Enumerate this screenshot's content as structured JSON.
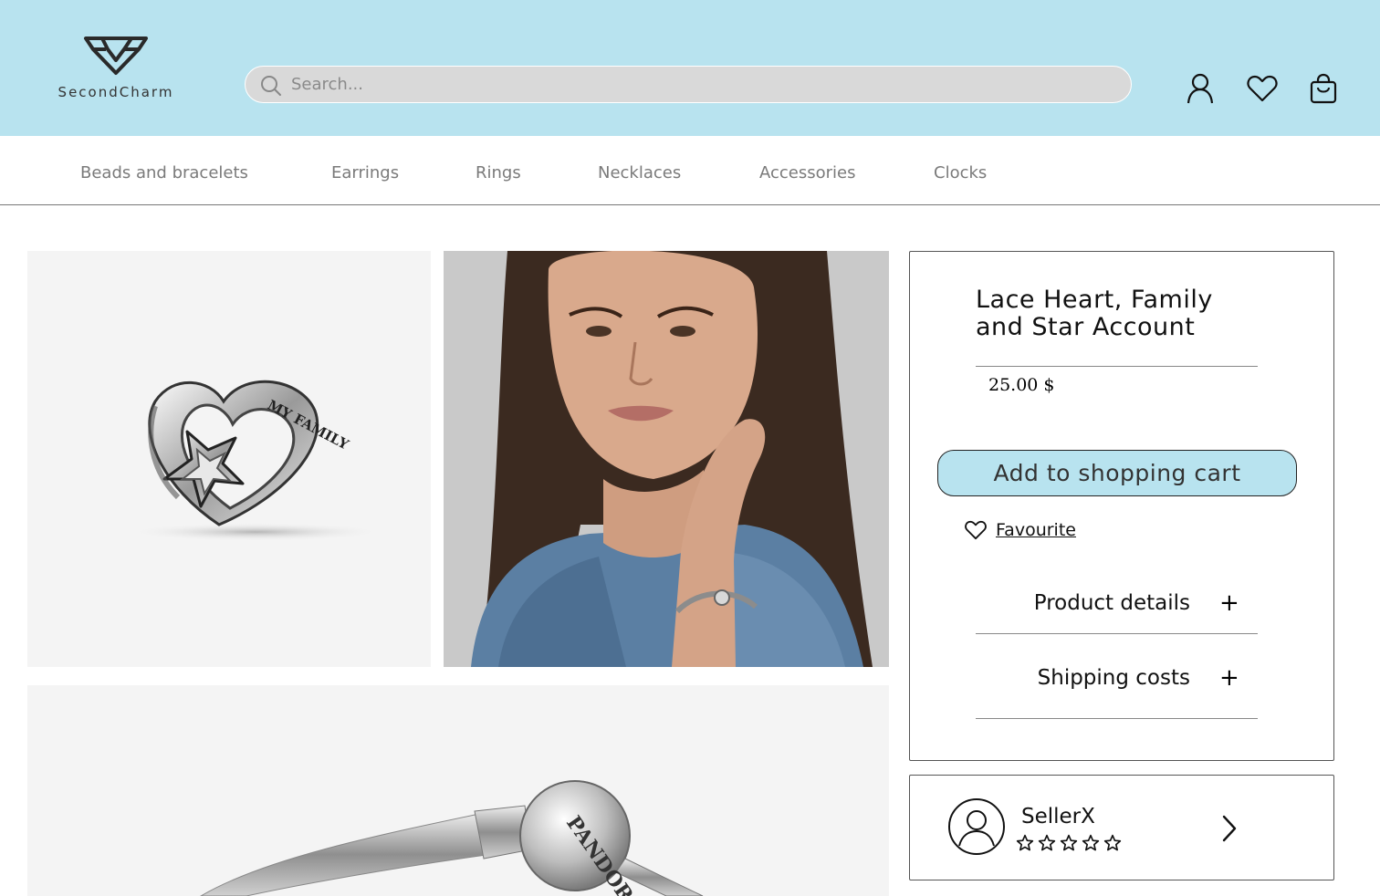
{
  "header": {
    "brand_name": "SecondCharm",
    "search": {
      "placeholder": "Search..."
    },
    "icons": [
      "user-icon",
      "heart-icon",
      "bag-icon"
    ]
  },
  "nav": {
    "items": [
      {
        "label": "Beads and bracelets"
      },
      {
        "label": "Earrings"
      },
      {
        "label": "Rings"
      },
      {
        "label": "Necklaces"
      },
      {
        "label": "Accessories"
      },
      {
        "label": "Clocks"
      }
    ]
  },
  "product": {
    "title": "Lace Heart, Family and Star Account",
    "price": "25.00 $",
    "add_to_cart_label": "Add to shopping cart",
    "favourite_label": "Favourite",
    "accordions": [
      {
        "label": "Product details"
      },
      {
        "label": "Shipping costs"
      }
    ],
    "charm_engraving": "MY FAMILY",
    "clasp_engraving": "PANDORA"
  },
  "seller": {
    "name": "SellerX",
    "rating": 0,
    "max_rating": 5
  },
  "colors": {
    "accent": "#b8e3ef",
    "search_bg": "#d9d9d9",
    "nav_text": "#7a7a7a"
  }
}
